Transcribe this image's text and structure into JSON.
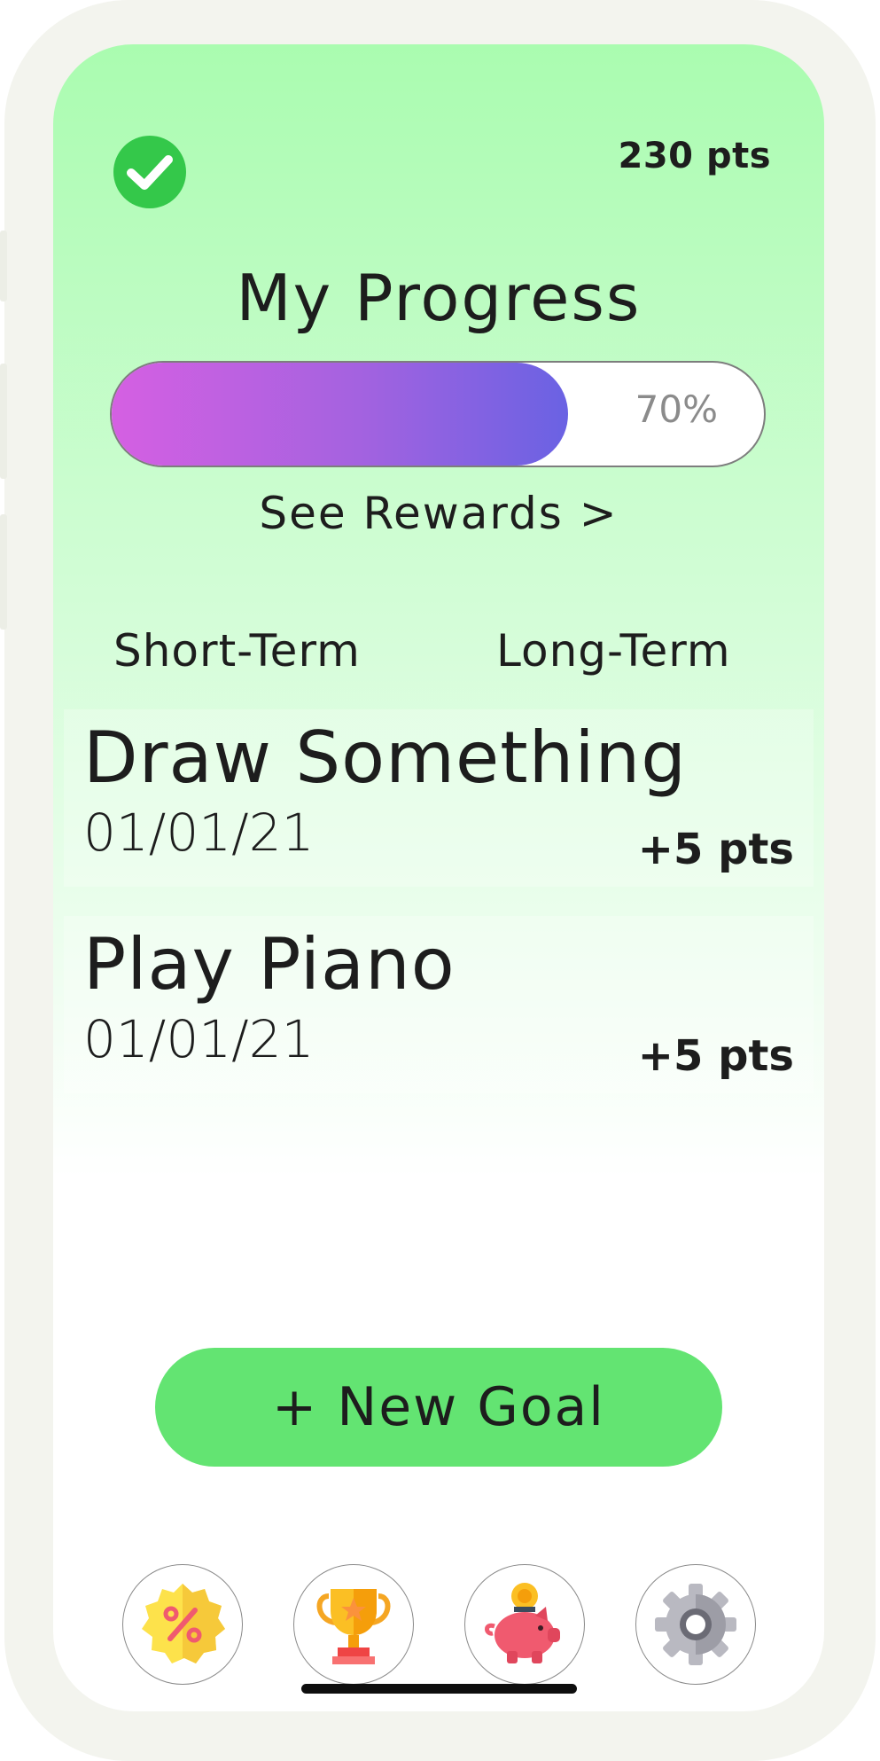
{
  "header": {
    "points_total": "230 pts",
    "status_icon": "check-circle-icon"
  },
  "progress": {
    "title": "My Progress",
    "percent_label": "70%",
    "fill_fraction": 0.7,
    "see_rewards_label": "See Rewards >"
  },
  "tabs": [
    {
      "label": "Short-Term"
    },
    {
      "label": "Long-Term"
    }
  ],
  "goals": [
    {
      "title": "Draw Something",
      "date": "01/01/21",
      "points": "+5 pts"
    },
    {
      "title": "Play Piano",
      "date": "01/01/21",
      "points": "+5 pts"
    }
  ],
  "new_goal_label": "+ New Goal",
  "bottom_nav": [
    {
      "icon": "discount-badge-icon"
    },
    {
      "icon": "trophy-icon"
    },
    {
      "icon": "piggy-bank-icon"
    },
    {
      "icon": "gear-icon"
    }
  ],
  "colors": {
    "screen_top": "#aafcb0",
    "accent_green": "#63e472",
    "check_green": "#34c84a",
    "progress_start": "#d560e2",
    "progress_end": "#6a62e3"
  }
}
